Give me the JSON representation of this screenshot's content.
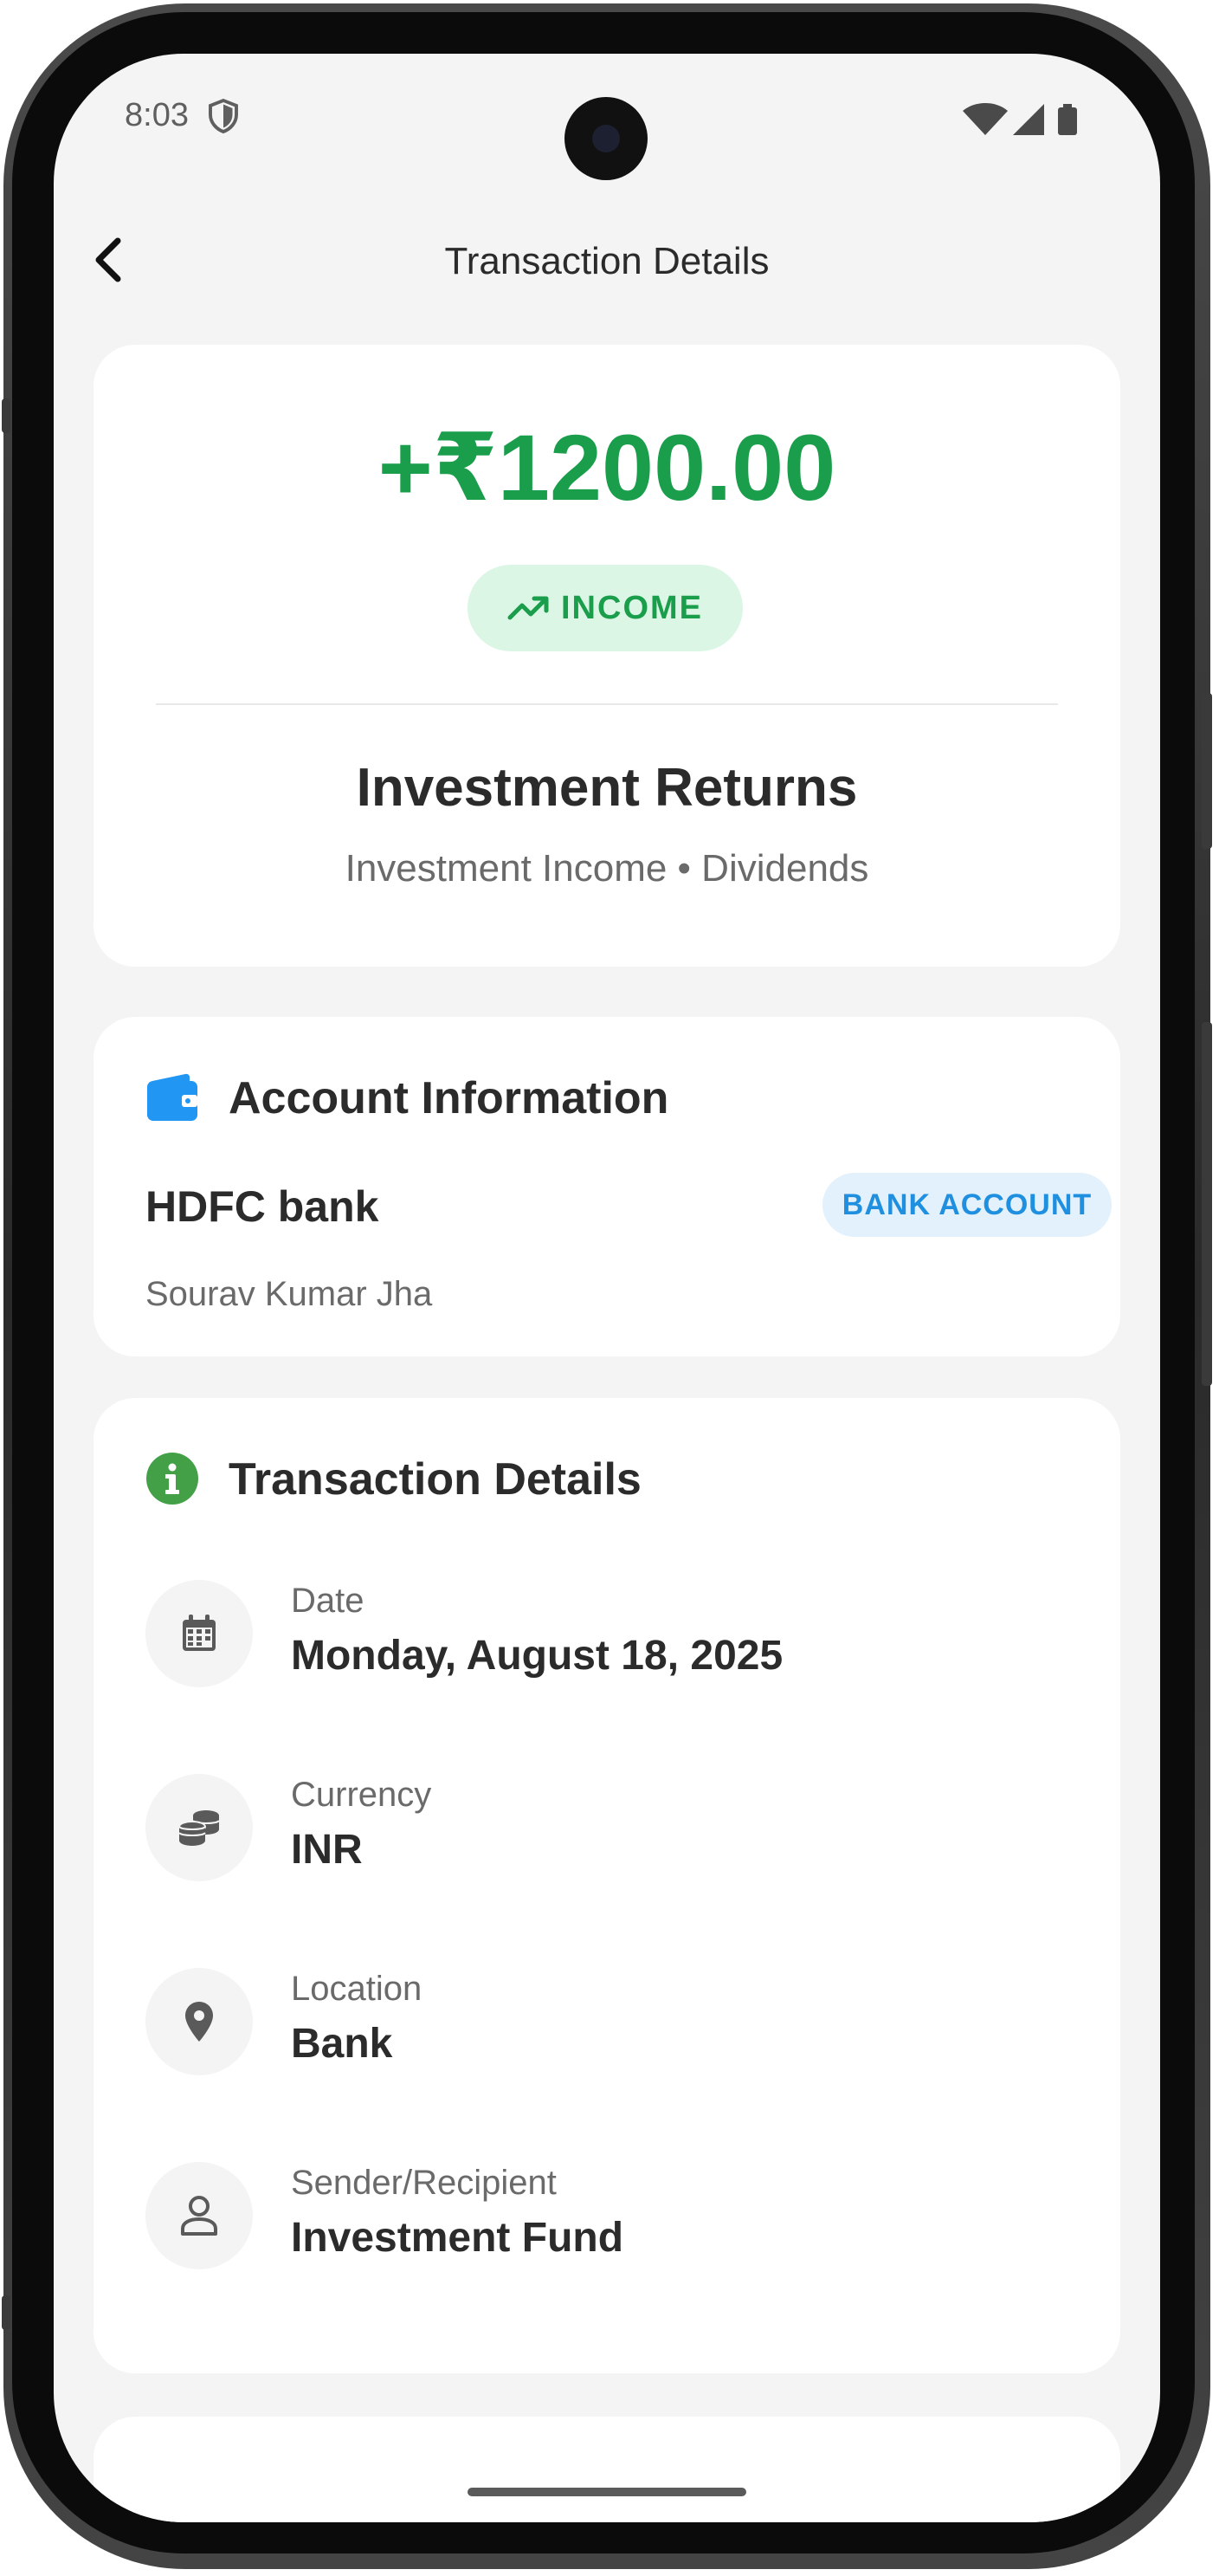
{
  "status_bar": {
    "time": "8:03",
    "icons": [
      "shield-icon",
      "wifi-icon",
      "signal-icon",
      "battery-icon"
    ]
  },
  "app_bar": {
    "back_icon": "chevron-left-icon",
    "title": "Transaction Details"
  },
  "summary": {
    "amount": "+₹1200.00",
    "type_label": "INCOME",
    "type_icon": "trending-up-icon",
    "title": "Investment Returns",
    "subtitle": "Investment Income • Dividends",
    "accent_color": "#1a9e4b"
  },
  "account": {
    "section_title": "Account Information",
    "section_icon": "wallet-icon",
    "bank_name": "HDFC bank",
    "account_type": "BANK ACCOUNT",
    "holder_name": "Sourav Kumar Jha",
    "accent_color": "#1f8fe0"
  },
  "details": {
    "section_title": "Transaction Details",
    "section_icon": "info-icon",
    "rows": [
      {
        "icon": "calendar-icon",
        "label": "Date",
        "value": "Monday, August 18, 2025"
      },
      {
        "icon": "coins-icon",
        "label": "Currency",
        "value": "INR"
      },
      {
        "icon": "location-pin-icon",
        "label": "Location",
        "value": "Bank"
      },
      {
        "icon": "person-icon",
        "label": "Sender/Recipient",
        "value": "Investment Fund"
      }
    ]
  }
}
